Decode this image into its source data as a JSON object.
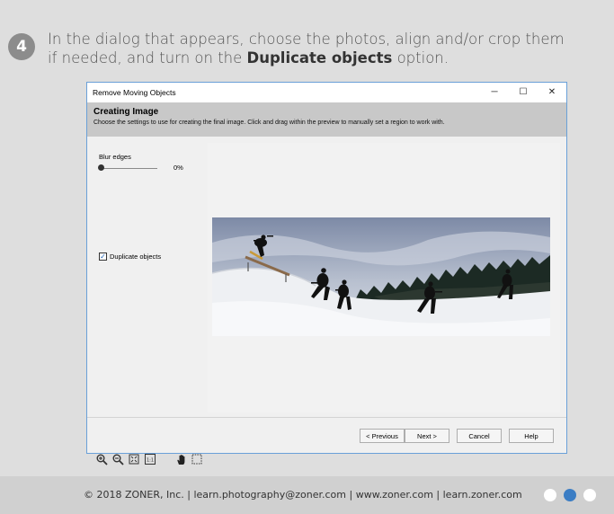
{
  "step": {
    "number": "4"
  },
  "instruction": {
    "text_before": "In the dialog that appears, choose the photos, align and/or crop them if needed, and turn on the ",
    "bold": "Duplicate objects",
    "text_after": " option."
  },
  "dialog": {
    "title": "Remove Moving Objects",
    "controls": {
      "minimize": "─",
      "maximize": "☐",
      "close": "✕"
    },
    "header": {
      "title": "Creating Image",
      "description": "Choose the settings to use for creating the final image. Click and drag within the preview to manually set a region to work with."
    },
    "settings": {
      "blur_label": "Blur edges",
      "blur_value": "0%",
      "blur_level": 0,
      "duplicate_label": "Duplicate objects",
      "duplicate_checked": true,
      "check_mark": "✓"
    },
    "tools": {
      "zoom_in": "zoom-in-icon",
      "zoom_out": "zoom-out-icon",
      "fit": "fit-screen-icon",
      "actual": "1:1",
      "hand": "hand-icon",
      "select": "selection-icon"
    },
    "buttons": {
      "previous": "< Previous",
      "next": "Next >",
      "cancel": "Cancel",
      "help": "Help"
    }
  },
  "footer": {
    "text": "© 2018 ZONER, Inc.  |  learn.photography@zoner.com  |  www.zoner.com  |  learn.zoner.com",
    "dots": [
      {
        "active": false
      },
      {
        "active": true,
        "color": "#3b7dc4"
      },
      {
        "active": false
      }
    ]
  }
}
